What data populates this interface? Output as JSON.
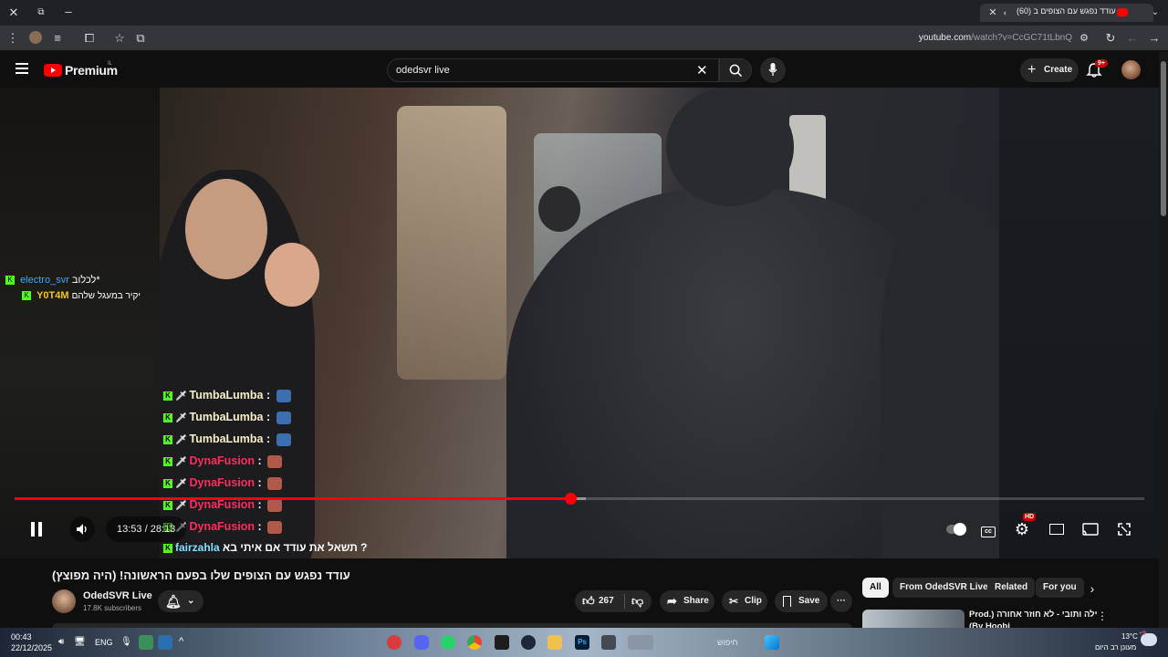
{
  "browser": {
    "tab_title": "(60) עודד נפגש עם הצופים ב",
    "url_host": "youtube.com",
    "url_path": "/watch?v=CcGC71tLbnQ"
  },
  "header": {
    "logo_text": "Premium",
    "logo_region": "IL",
    "search_value": "odedsvr live",
    "create_label": "Create",
    "notification_count": "9+"
  },
  "overlay_chat": [
    {
      "user": "electro_svr",
      "message": "*לכלוב",
      "color": "#3ea6ff"
    },
    {
      "user": "Y0T4M",
      "message": "יקיר במעגל שלהם",
      "color": "#f5c518"
    }
  ],
  "video_chat": [
    {
      "user": "TumbaLumba",
      "color": "#f5f0c8"
    },
    {
      "user": "TumbaLumba",
      "color": "#f5f0c8"
    },
    {
      "user": "TumbaLumba",
      "color": "#f5f0c8"
    },
    {
      "user": "DynaFusion",
      "color": "#ff2b5e"
    },
    {
      "user": "DynaFusion",
      "color": "#ff2b5e"
    },
    {
      "user": "DynaFusion",
      "color": "#ff2b5e"
    },
    {
      "user": "DynaFusion",
      "color": "#ff2b5e"
    }
  ],
  "video_chat_last": "? תשאל את עודד אם איתי בא",
  "player": {
    "current_time": "13:53",
    "duration": "28:13",
    "time_display": "13:53 / 28:13",
    "progress_fraction": 0.492,
    "buffer_fraction": 0.506,
    "hd_badge": "HD"
  },
  "video": {
    "title": "עודד נפגש עם הצופים שלו בפעם הראשונה! (היה מפוצץ)",
    "channel_name": "OdedSVR Live",
    "subscribers": "17.8K subscribers",
    "likes": "267",
    "share_label": "Share",
    "clip_label": "Clip",
    "save_label": "Save"
  },
  "recommendations": {
    "chips": [
      "All",
      "From OdedSVR Live",
      "Related",
      "For you"
    ],
    "first_title": "Prod.) סטילה ותובי - לא חוזר אחורה",
    "first_title_line2": "(By Hoobi"
  },
  "taskbar": {
    "time": "00:43",
    "date": "22/12/2025",
    "lang": "ENG",
    "weather_temp": "13°C",
    "weather_desc": "מעונן רב היום",
    "weather_badge": "+9",
    "search_placeholder": "חיפוש"
  },
  "colors": {
    "youtube_red": "#ff0000",
    "kick_green": "#53fc18",
    "link_blue": "#3ea6ff"
  }
}
